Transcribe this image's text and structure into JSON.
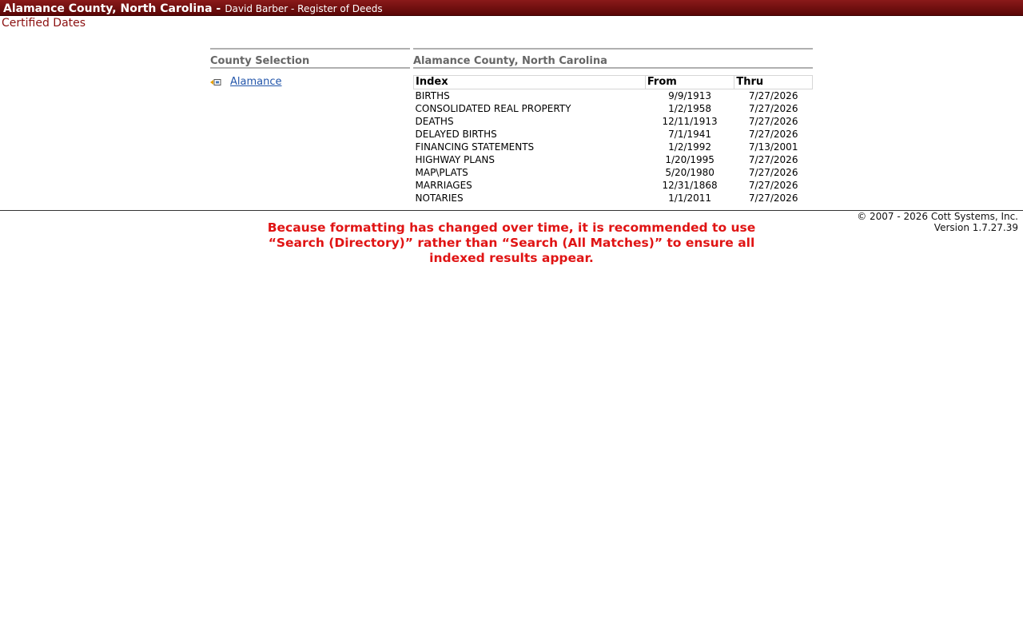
{
  "header": {
    "county_title": "Alamance County, North Carolina -",
    "recorder": "David Barber - Register of Deeds"
  },
  "page_subtitle": "Certified Dates",
  "county_selection": {
    "heading": "County Selection",
    "link_label": "Alamance",
    "link_icon": "arrow-select-icon"
  },
  "detail": {
    "heading": "Alamance County, North Carolina",
    "columns": [
      "Index",
      "From",
      "Thru"
    ],
    "rows": [
      {
        "index": "BIRTHS",
        "from": "9/9/1913",
        "thru": "7/27/2026"
      },
      {
        "index": "CONSOLIDATED REAL PROPERTY",
        "from": "1/2/1958",
        "thru": "7/27/2026"
      },
      {
        "index": "DEATHS",
        "from": "12/11/1913",
        "thru": "7/27/2026"
      },
      {
        "index": "DELAYED BIRTHS",
        "from": "7/1/1941",
        "thru": "7/27/2026"
      },
      {
        "index": "FINANCING STATEMENTS",
        "from": "1/2/1992",
        "thru": "7/13/2001"
      },
      {
        "index": "HIGHWAY PLANS",
        "from": "1/20/1995",
        "thru": "7/27/2026"
      },
      {
        "index": "MAP\\PLATS",
        "from": "5/20/1980",
        "thru": "7/27/2026"
      },
      {
        "index": "MARRIAGES",
        "from": "12/31/1868",
        "thru": "7/27/2026"
      },
      {
        "index": "NOTARIES",
        "from": "1/1/2011",
        "thru": "7/27/2026"
      }
    ]
  },
  "footer": {
    "copyright": "© 2007 - 2026 Cott Systems, Inc.",
    "version": "Version 1.7.27.39"
  },
  "notice": "Because formatting has changed over time, it is recommended to use “Search (Directory)” rather than “Search (All Matches)” to ensure all indexed results appear.",
  "colors": {
    "header_bar": "#6e0e0e",
    "subtitle": "#8b1010",
    "notice": "#e01414",
    "link": "#2255aa"
  }
}
